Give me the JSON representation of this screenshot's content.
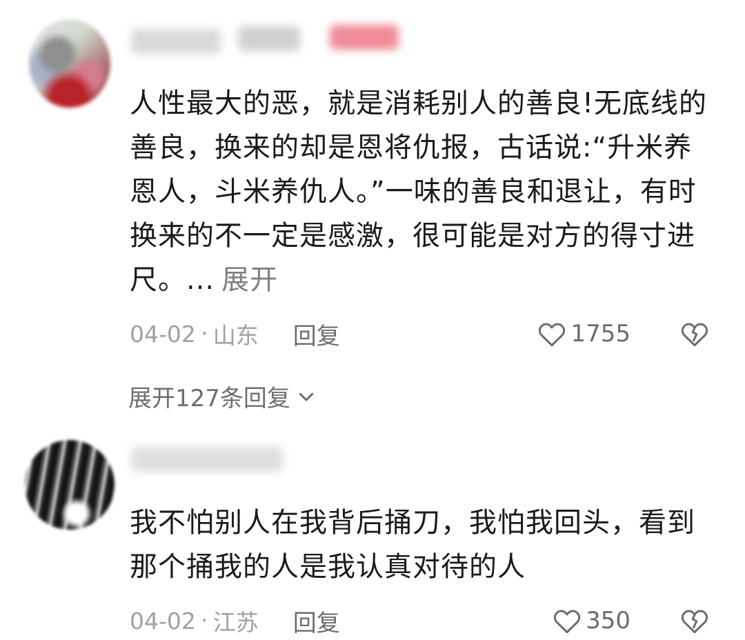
{
  "comments": [
    {
      "text": "人性最大的恶，就是消耗别人的善良!无底线的善良，换来的却是恩将仇报，古话说:“升米养恩人，斗米养仇人。”一味的善良和退让，有时换来的不一定是感激，很可能是对方的得寸进尺。...",
      "expand_label": "展开",
      "date": "04-02",
      "separator": "·",
      "location": "山东",
      "reply_label": "回复",
      "like_count": "1755",
      "expand_replies_label": "展开127条回复"
    },
    {
      "text": "我不怕别人在我背后捅刀，我怕我回头，看到那个捅我的人是我认真对待的人",
      "date": "04-02",
      "separator": "·",
      "location": "江苏",
      "reply_label": "回复",
      "like_count": "350"
    }
  ],
  "icons": {
    "like": "heart-outline-icon",
    "dislike": "broken-heart-icon",
    "expand": "chevron-down-icon"
  },
  "colors": {
    "text": "#1a1a1a",
    "meta": "#a0a0a0",
    "action": "#6d6d6d"
  }
}
